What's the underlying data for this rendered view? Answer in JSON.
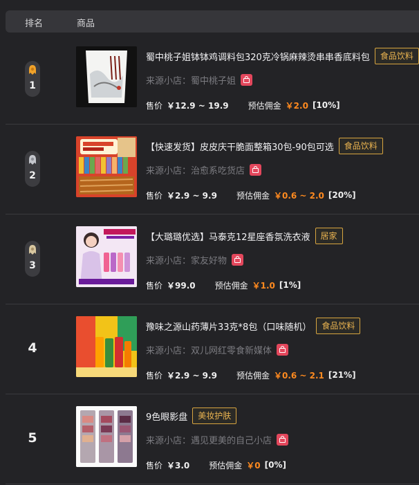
{
  "header": {
    "rank_label": "排名",
    "product_label": "商品"
  },
  "colors": {
    "background": "#232326",
    "header": "#36363a",
    "tag_border": "#d9a640",
    "commission": "#ff8a1f",
    "shop_icon": "#e3475c"
  },
  "rows": [
    {
      "rank": "1",
      "medal": "gold-medal-icon",
      "title": "蜀中桃子姐钵钵鸡调料包320克冷锅麻辣烫串串香底料包",
      "tag": "食品饮料",
      "shop_label": "来源小店：",
      "shop_name": "蜀中桃子姐",
      "price_label": "售价",
      "price": "￥12.9 ~ 19.9",
      "commission_label": "预估佣金",
      "commission": "￥2.0",
      "rate": "[10%]"
    },
    {
      "rank": "2",
      "medal": "silver-medal-icon",
      "title": "【快速发货】皮皮庆干脆面整箱30包-90包可选",
      "tag": "食品饮料",
      "shop_label": "来源小店：",
      "shop_name": "治愈系吃货店",
      "price_label": "售价",
      "price": "￥2.9 ~ 9.9",
      "commission_label": "预估佣金",
      "commission": "￥0.6 ~ 2.0",
      "rate": "[20%]"
    },
    {
      "rank": "3",
      "medal": "bronze-medal-icon",
      "title": "【大璐璐优选】马泰克12星座香氛洗衣液",
      "tag": "居家",
      "shop_label": "来源小店：",
      "shop_name": "家友好物",
      "price_label": "售价",
      "price": "￥99.0",
      "commission_label": "预估佣金",
      "commission": "￥1.0",
      "rate": "[1%]"
    },
    {
      "rank": "4",
      "title": "豫味之源山药薄片33克*8包（口味随机）",
      "tag": "食品饮料",
      "shop_label": "来源小店：",
      "shop_name": "双儿网红零食新媒体",
      "price_label": "售价",
      "price": "￥2.9 ~ 9.9",
      "commission_label": "预估佣金",
      "commission": "￥0.6 ~ 2.1",
      "rate": "[21%]"
    },
    {
      "rank": "5",
      "title": "9色眼影盘",
      "tag": "美妆护肤",
      "shop_label": "来源小店：",
      "shop_name": "遇见更美的自己小店",
      "price_label": "售价",
      "price": "￥3.0",
      "commission_label": "预估佣金",
      "commission": "￥0",
      "rate": "[0%]"
    }
  ]
}
